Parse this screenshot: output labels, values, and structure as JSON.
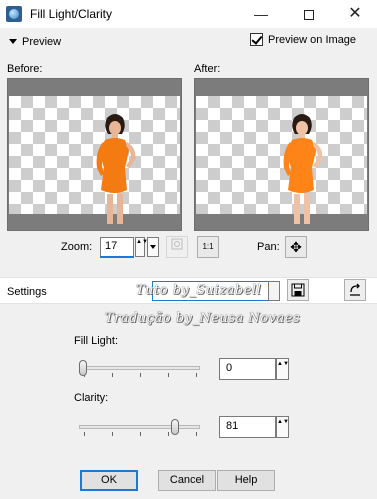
{
  "window": {
    "title": "Fill Light/Clarity",
    "minimize": "—",
    "close": "✕"
  },
  "preview": {
    "section_label": "Preview",
    "checkbox_label": "Preview on Image",
    "checked": true
  },
  "panes": {
    "before_label": "Before:",
    "after_label": "After:"
  },
  "zoom": {
    "label": "Zoom:",
    "value": "17",
    "fit_icon": "zoom-fit-icon",
    "actual_label": "1:1",
    "spin": "▲▼"
  },
  "pan": {
    "label": "Pan:",
    "icon": "✥"
  },
  "settings": {
    "label": "Settings",
    "preset_value": "",
    "save_icon": "💾",
    "reset_icon": "⭯"
  },
  "watermark": {
    "line1": "Tuto by_Suizabell",
    "line2": "Tradução by_Neusa Novaes"
  },
  "fill_light": {
    "label": "Fill Light:",
    "value": "0",
    "level_percent": 0
  },
  "clarity": {
    "label": "Clarity:",
    "value": "81",
    "level_percent": 81
  },
  "buttons": {
    "ok": "OK",
    "cancel": "Cancel",
    "help": "Help"
  },
  "colors": {
    "accent": "#1e78d6",
    "dress": "#f47a12",
    "background": "#f0f0f0"
  }
}
